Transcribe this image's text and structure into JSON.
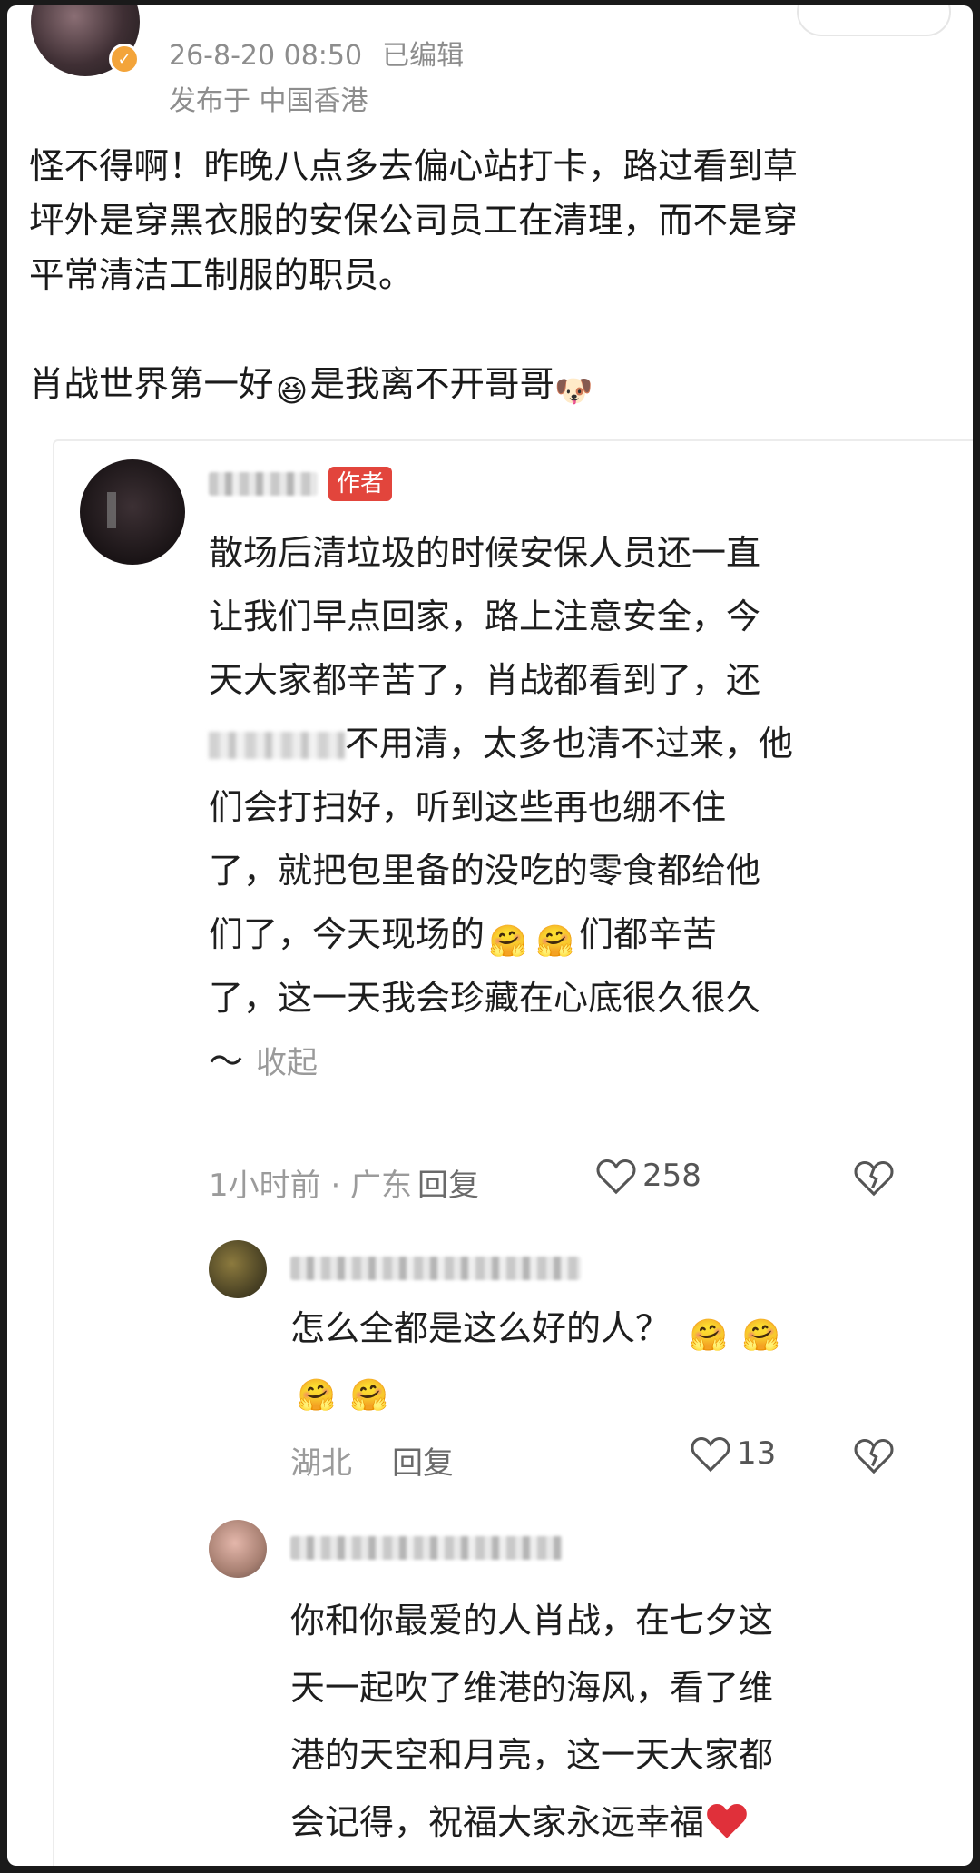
{
  "post": {
    "date": "26-8-20 08:50",
    "edited": "已编辑",
    "location": "发布于 中国香港",
    "body_line1": "怪不得啊！昨晚八点多去偏心站打卡，路过看到草",
    "body_line2": "坪外是穿黑衣服的安保公司员工在清理，而不是穿",
    "body_line3": "平常清洁工制服的职员。",
    "body_line4_a": "肖战世界第一好",
    "body_line4_b": "是我离不开哥哥"
  },
  "comment": {
    "author_tag": "作者",
    "text_lines": [
      "散场后清垃圾的时候安保人员还一直",
      "让我们早点回家，路上注意安全，今",
      "天大家都辛苦了，肖战都看到了，还"
    ],
    "text_line4_after_blur": "不用清，太多也清不过来，他",
    "text_lines_rest": [
      "们会打扫好，听到这些再也绷不住",
      "了，就把包里备的没吃的零食都给他"
    ],
    "text_line7_a": "们了，今天现场的",
    "text_line7_b": "们都辛苦",
    "text_line8": "了，这一天我会珍藏在心底很久很久",
    "tilde": "～",
    "collapse": "收起",
    "time_location": "1小时前 · 广东",
    "reply": "回复",
    "likes": "258"
  },
  "reply1": {
    "text": "怎么全都是这么好的人？",
    "location": "湖北",
    "reply": "回复",
    "likes": "13"
  },
  "reply2": {
    "text_lines": [
      "你和你最爱的人肖战，在七夕这",
      "天一起吹了维港的海风，看了维",
      "港的天空和月亮，这一天大家都"
    ],
    "text_last": "会记得，祝福大家永远幸福"
  },
  "colors": {
    "author_tag": "#e2453c",
    "verify_badge": "#f3a43a",
    "meta_gray": "#8d8d8d"
  },
  "icons": [
    "verified-badge-icon",
    "heart-outline-icon",
    "broken-heart-icon",
    "grinning-emoji-icon",
    "hug-emoji-icon",
    "red-heart-emoji-icon"
  ]
}
